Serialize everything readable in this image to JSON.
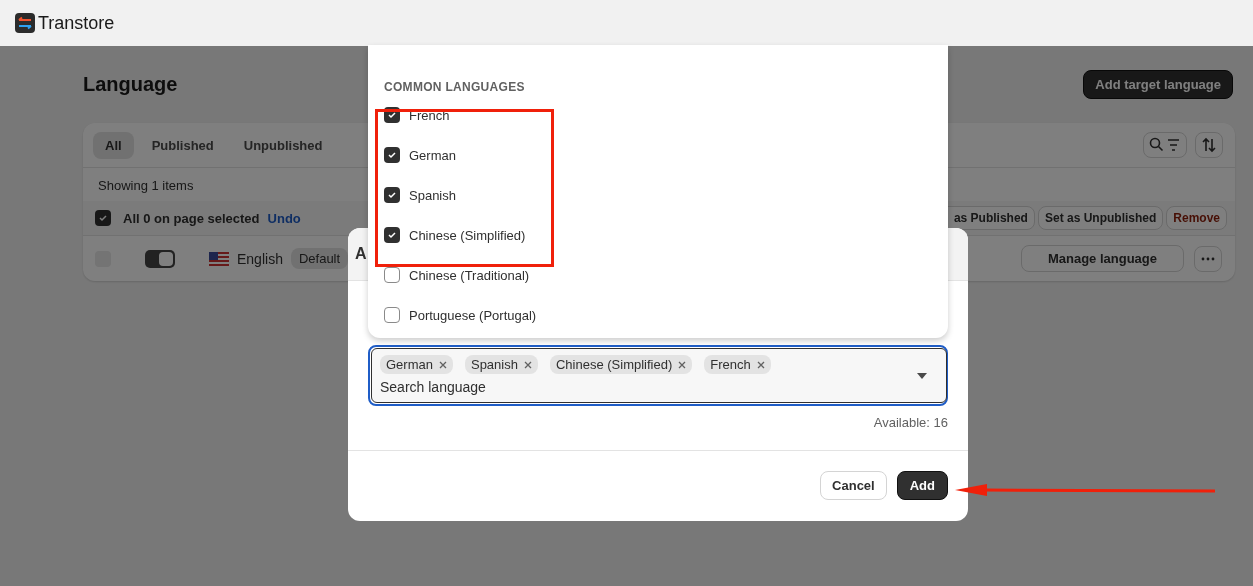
{
  "app": {
    "name": "Transtore"
  },
  "page": {
    "title": "Language",
    "primary_action": "Add target language"
  },
  "tabs": [
    {
      "label": "All",
      "selected": true
    },
    {
      "label": "Published",
      "selected": false
    },
    {
      "label": "Unpublished",
      "selected": false
    }
  ],
  "summary": "Showing 1 items",
  "bulk": {
    "checked": true,
    "label": "All 0 on page selected",
    "undo": "Undo",
    "actions": [
      {
        "label": "as Published",
        "kind": "normal"
      },
      {
        "label": "Set as Unpublished",
        "kind": "normal"
      },
      {
        "label": "Remove",
        "kind": "destructive"
      }
    ]
  },
  "rows": [
    {
      "checked": false,
      "on": true,
      "language": "English",
      "badge": "Default",
      "action": "Manage language"
    }
  ],
  "dialog": {
    "title": "A",
    "tags": [
      "German",
      "Spanish",
      "Chinese (Simplified)",
      "French"
    ],
    "search": {
      "placeholder": "Search language"
    },
    "available": "Available:  16",
    "cancel": "Cancel",
    "add": "Add"
  },
  "dropdown": {
    "heading": "COMMON LANGUAGES",
    "options": [
      {
        "label": "French",
        "checked": true
      },
      {
        "label": "German",
        "checked": true
      },
      {
        "label": "Spanish",
        "checked": true
      },
      {
        "label": "Chinese (Simplified)",
        "checked": true
      },
      {
        "label": "Chinese (Traditional)",
        "checked": false
      },
      {
        "label": "Portuguese (Portugal)",
        "checked": false
      }
    ]
  }
}
